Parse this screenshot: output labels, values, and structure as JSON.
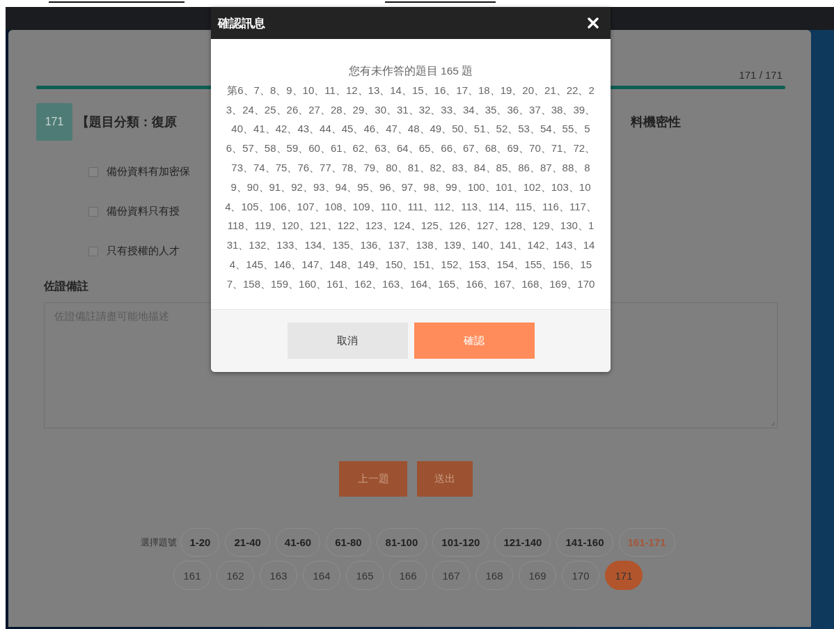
{
  "progress": {
    "text": "171 / 171",
    "level": 1
  },
  "question": {
    "number": "171",
    "title_parts": [
      "【題目分類：復原",
      "料機密性"
    ],
    "options": [
      {
        "label": "備份資料有加密保",
        "checked": false
      },
      {
        "label": "備份資料只有授",
        "checked": false
      },
      {
        "label": "只有授權的人才",
        "checked": false
      }
    ]
  },
  "note": {
    "label": "佐證備註",
    "placeholder": "佐證備註請盡可能地描述"
  },
  "nav_buttons": [
    "上一題",
    "送出"
  ],
  "pagination": {
    "label": "選擇題號",
    "ranges": [
      {
        "label": "1-20",
        "selected": false
      },
      {
        "label": "21-40",
        "selected": false
      },
      {
        "label": "41-60",
        "selected": false
      },
      {
        "label": "61-80",
        "selected": false
      },
      {
        "label": "81-100",
        "selected": false
      },
      {
        "label": "101-120",
        "selected": false
      },
      {
        "label": "121-140",
        "selected": false
      },
      {
        "label": "141-160",
        "selected": false
      },
      {
        "label": "161-171",
        "selected": true
      }
    ],
    "numbers": [
      {
        "label": "161",
        "selected": false
      },
      {
        "label": "162",
        "selected": false
      },
      {
        "label": "163",
        "selected": false
      },
      {
        "label": "164",
        "selected": false
      },
      {
        "label": "165",
        "selected": false
      },
      {
        "label": "166",
        "selected": false
      },
      {
        "label": "167",
        "selected": false
      },
      {
        "label": "168",
        "selected": false
      },
      {
        "label": "169",
        "selected": false
      },
      {
        "label": "170",
        "selected": false
      },
      {
        "label": "171",
        "selected": true
      }
    ]
  },
  "dialog": {
    "title": "確認訊息",
    "message": "您有未作答的題目 165 題",
    "list": "第6、7、8、9、10、11、12、13、14、15、16、17、18、19、20、21、22、23、24、25、26、27、28、29、30、31、32、33、34、35、36、37、38、39、40、41、42、43、44、45、46、47、48、49、50、51、52、53、54、55、56、57、58、59、60、61、62、63、64、65、66、67、68、69、70、71、72、73、74、75、76、77、78、79、80、81、82、83、84、85、86、87、88、89、90、91、92、93、94、95、96、97、98、99、100、101、102、103、104、105、106、107、108、109、110、111、112、113、114、115、116、117、118、119、120、121、122、123、124、125、126、127、128、129、130、131、132、133、134、135、136、137、138、139、140、141、142、143、144、145、146、147、148、149、150、151、152、153、154、155、156、157、158、159、160、161、162、163、164、165、166、167、168、169、170",
    "buttons": [
      {
        "label": "取消",
        "kind": "cancel"
      },
      {
        "label": "確認",
        "kind": "confirm"
      }
    ]
  }
}
